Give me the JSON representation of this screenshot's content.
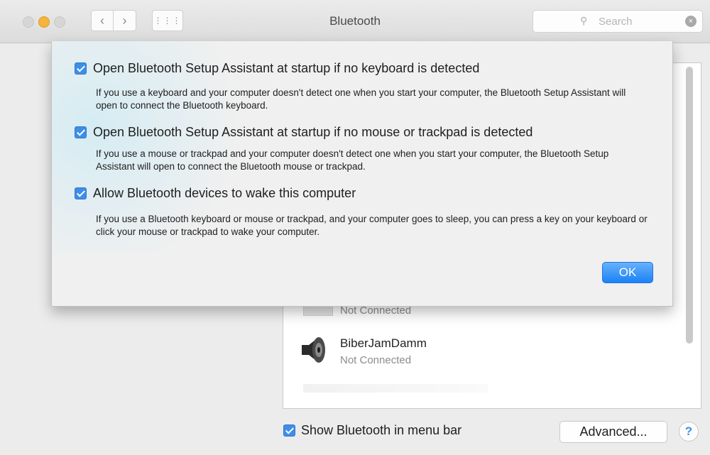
{
  "window": {
    "title": "Bluetooth",
    "search_placeholder": "Search"
  },
  "icons": {
    "back": "chevron-left",
    "forward": "chevron-right",
    "grid": "show-all-grid",
    "search": "magnifier",
    "clear": "clear-x",
    "speaker": "speaker",
    "help": "question-mark"
  },
  "colors": {
    "accent": "#3e8ee8",
    "traffic_light_min": "#f5b53b"
  },
  "dialog": {
    "options": [
      {
        "checked": true,
        "label": "Open Bluetooth Setup Assistant at startup if no keyboard is detected",
        "description": "If you use a keyboard and your computer doesn't detect one when you start your computer, the Bluetooth Setup Assistant will open to connect the Bluetooth keyboard."
      },
      {
        "checked": true,
        "label": "Open Bluetooth Setup Assistant at startup if no mouse or trackpad is detected",
        "description": "If you use a mouse or trackpad and your computer doesn't detect one when you start your computer, the Bluetooth Setup Assistant will open to connect the Bluetooth mouse or trackpad."
      },
      {
        "checked": true,
        "label": "Allow Bluetooth devices to wake this computer",
        "description": "If you use a Bluetooth keyboard or mouse or trackpad, and your computer goes to sleep, you can press a key on your keyboard or click your mouse or trackpad to wake your computer."
      }
    ],
    "ok_label": "OK"
  },
  "devices": [
    {
      "name": "",
      "status": "Not Connected"
    },
    {
      "name": "BiberJamDamm",
      "status": "Not Connected"
    }
  ],
  "footer": {
    "show_in_menu_bar_checked": true,
    "show_in_menu_bar_label": "Show Bluetooth in menu bar",
    "advanced_label": "Advanced...",
    "help_label": "?"
  }
}
